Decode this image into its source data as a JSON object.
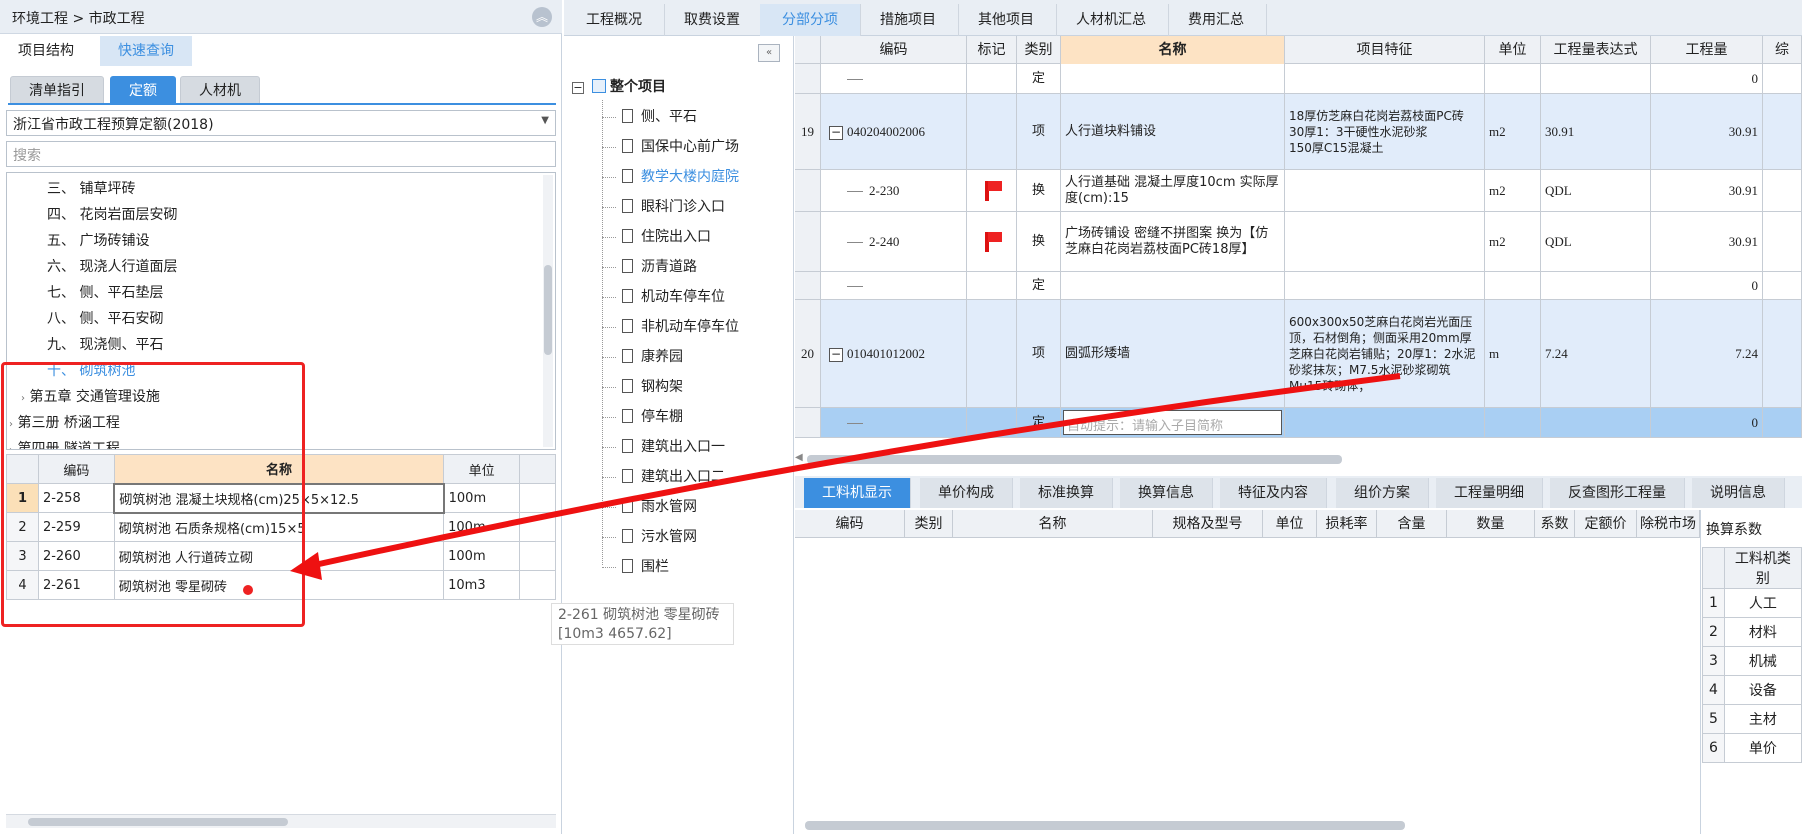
{
  "left": {
    "breadcrumb": "环境工程 > 市政工程",
    "tabs": [
      "项目结构",
      "快速查询"
    ],
    "sub_tabs": [
      "清单指引",
      "定额",
      "人材机"
    ],
    "quota_select": "浙江省市政工程预算定额(2018)",
    "search_placeholder": "搜索",
    "tree": [
      "三、 铺草坪砖",
      "四、 花岗岩面层安砌",
      "五、 广场砖铺设",
      "六、 现浇人行道面层",
      "七、 侧、平石垫层",
      "八、 侧、平石安砌",
      "九、 现浇侧、平石",
      "十、 砌筑树池",
      "第五章 交通管理设施",
      "第三册 桥涵工程",
      "第四册 隧道工程"
    ],
    "table_headers": [
      "编码",
      "名称",
      "单位"
    ],
    "table_rows": [
      {
        "idx": "1",
        "code": "2-258",
        "name": "砌筑树池 混凝土块规格(cm)25×5×12.5",
        "unit": "100m"
      },
      {
        "idx": "2",
        "code": "2-259",
        "name": "砌筑树池 石质条规格(cm)15×5",
        "unit": "100m"
      },
      {
        "idx": "3",
        "code": "2-260",
        "name": "砌筑树池 人行道砖立砌",
        "unit": "100m"
      },
      {
        "idx": "4",
        "code": "2-261",
        "name": "砌筑树池 零星砌砖",
        "unit": "10m3"
      }
    ]
  },
  "mid": {
    "root": "整个项目",
    "items": [
      "侧、平石",
      "国保中心前广场",
      "教学大楼内庭院",
      "眼科门诊入口",
      "住院出入口",
      "沥青道路",
      "机动车停车位",
      "非机动车停车位",
      "康养园",
      "钢构架",
      "停车棚",
      "建筑出入口一",
      "建筑出入口二",
      "雨水管网",
      "污水管网",
      "围栏"
    ],
    "tooltip_line1": "2-261 砌筑树池 零星砌砖",
    "tooltip_line2": "[10m3 4657.62]"
  },
  "top_tabs": [
    "工程概况",
    "取费设置",
    "分部分项",
    "措施项目",
    "其他项目",
    "人材机汇总",
    "费用汇总"
  ],
  "grid": {
    "headers": [
      "编码",
      "标记",
      "类别",
      "名称",
      "项目特征",
      "单位",
      "工程量表达式",
      "工程量",
      "综"
    ],
    "rows": [
      {
        "num": "",
        "code": "",
        "type": "定",
        "name": "",
        "feature": "",
        "unit": "",
        "expr": "",
        "qty": "0"
      },
      {
        "num": "19",
        "code": "040204002006",
        "type": "项",
        "name": "人行道块料铺设",
        "feature": "18厚仿芝麻白花岗岩荔枝面PC砖\n30厚1：3干硬性水泥砂浆\n150厚C15混凝土",
        "unit": "m2",
        "expr": "30.91",
        "qty": "30.91"
      },
      {
        "num": "",
        "code": "2-230",
        "type": "换",
        "name": "人行道基础 混凝土厚度10cm 实际厚度(cm):15",
        "feature": "",
        "unit": "m2",
        "expr": "QDL",
        "qty": "30.91"
      },
      {
        "num": "",
        "code": "2-240",
        "type": "换",
        "name": "广场砖铺设 密缝不拼图案 换为【仿芝麻白花岗岩荔枝面PC砖18厚】",
        "feature": "",
        "unit": "m2",
        "expr": "QDL",
        "qty": "30.91"
      },
      {
        "num": "",
        "code": "",
        "type": "定",
        "name": "",
        "feature": "",
        "unit": "",
        "expr": "",
        "qty": "0"
      },
      {
        "num": "20",
        "code": "010401012002",
        "type": "项",
        "name": "圆弧形矮墙",
        "feature": "600x300x50芝麻白花岗岩光面压顶，石材倒角；侧面采用20mm厚芝麻白花岗岩铺贴；20厚1：2水泥砂浆抹灰；M7.5水泥砂浆砌筑Mu15砖砌体；",
        "unit": "m",
        "expr": "7.24",
        "qty": "7.24"
      },
      {
        "num": "",
        "code": "",
        "type": "定",
        "name": "",
        "name_placeholder": "自动提示：请输入子目简称",
        "feature": "",
        "unit": "",
        "expr": "",
        "qty": "0"
      }
    ]
  },
  "bottom_tabs": [
    "工料机显示",
    "单价构成",
    "标准换算",
    "换算信息",
    "特征及内容",
    "组价方案",
    "工程量明细",
    "反查图形工程量",
    "说明信息"
  ],
  "bottom_headers": [
    "编码",
    "类别",
    "名称",
    "规格及型号",
    "单位",
    "损耗率",
    "含量",
    "数量",
    "系数",
    "定额价",
    "除税市场"
  ],
  "conversion": {
    "title": "换算系数",
    "header": "工料机类别",
    "rows": [
      {
        "idx": "1",
        "name": "人工"
      },
      {
        "idx": "2",
        "name": "材料"
      },
      {
        "idx": "3",
        "name": "机械"
      },
      {
        "idx": "4",
        "name": "设备"
      },
      {
        "idx": "5",
        "name": "主材"
      },
      {
        "idx": "6",
        "name": "单价"
      }
    ]
  },
  "colors": {
    "accent": "#3c8fe0",
    "highlight_border": "#ee2222",
    "selected_row": "#a9cff3",
    "header_active": "#fde3c4"
  }
}
